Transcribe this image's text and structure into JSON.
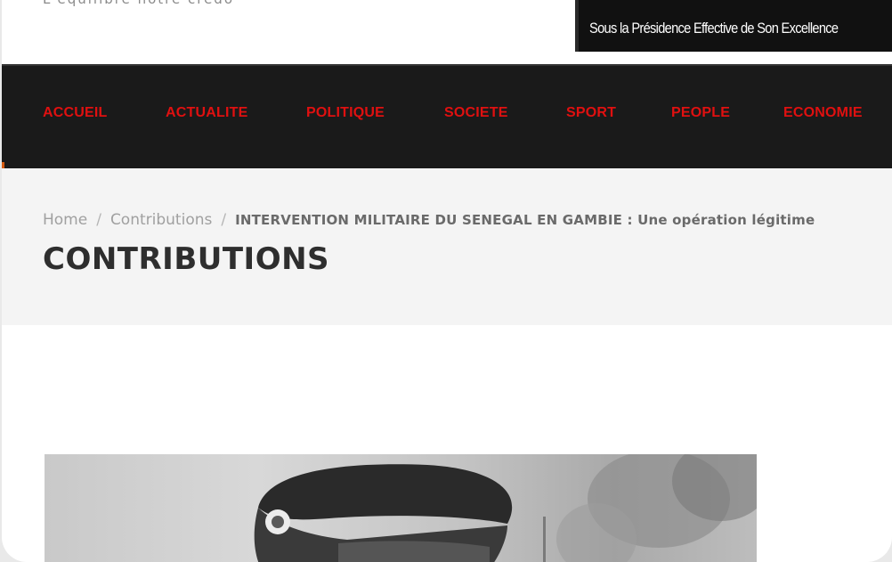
{
  "header": {
    "tagline": "L'équilibre notre crédo",
    "banner_text": "Sous la Présidence Effective de Son Excellence"
  },
  "nav": {
    "items": [
      {
        "label": "ACCUEIL"
      },
      {
        "label": "ACTUALITE"
      },
      {
        "label": "POLITIQUE"
      },
      {
        "label": "SOCIETE"
      },
      {
        "label": "SPORT"
      },
      {
        "label": "PEOPLE"
      },
      {
        "label": "ECONOMIE"
      }
    ]
  },
  "breadcrumb": {
    "home": "Home",
    "separator": "/",
    "section": "Contributions",
    "current": "INTERVENTION MILITAIRE DU SENEGAL EN GAMBIE : Une opération légitime"
  },
  "page": {
    "title": "CONTRIBUTIONS"
  },
  "colors": {
    "nav_background": "#1a1a1a",
    "nav_text": "#e01010",
    "heading_band": "#f4f4f4"
  }
}
